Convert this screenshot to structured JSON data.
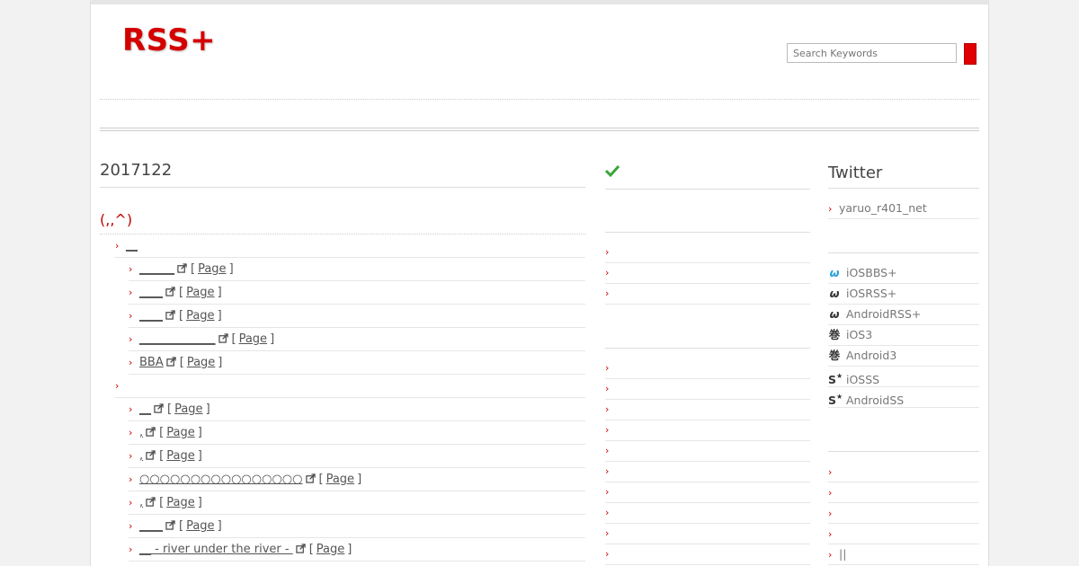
{
  "header": {
    "logo": "RSS+",
    "search_placeholder": "Search Keywords"
  },
  "main": {
    "title": "2017122",
    "section_title": "(,,^)",
    "page_link": "Page",
    "groups": [
      {
        "label": "__",
        "items": [
          {
            "text": "______"
          },
          {
            "text": "____"
          },
          {
            "text": "____"
          },
          {
            "text": "_____________"
          },
          {
            "text": "BBA"
          }
        ]
      },
      {
        "label": "",
        "items": [
          {
            "text": "__"
          },
          {
            "text": ","
          },
          {
            "text": ","
          },
          {
            "text": "○○○○○○○○○○○○○○○○"
          },
          {
            "text": ","
          },
          {
            "text": "____"
          },
          {
            "text": "__ - river under the river - "
          }
        ]
      }
    ]
  },
  "middle": {
    "check_icon": "checkmark-icon",
    "rows_a": [
      "",
      "",
      ""
    ],
    "rows_b": [
      "",
      "",
      "",
      "",
      "",
      "",
      "",
      "",
      "",
      ""
    ]
  },
  "sidebar": {
    "title": "Twitter",
    "twitter_account": "yaruo_r401_net",
    "apps": [
      {
        "icon": "ω",
        "icon_name": "omega-icon",
        "label": "iOSBBS+",
        "color": "#2a9fd6"
      },
      {
        "icon": "ω",
        "icon_name": "omega-icon",
        "label": "iOSRSS+",
        "color": "#333333"
      },
      {
        "icon": "ω",
        "icon_name": "omega-icon",
        "label": "AndroidRSS+",
        "color": "#333333"
      },
      {
        "icon": "巻",
        "icon_name": "scroll-kanji-icon",
        "label": "iOS3",
        "color": "#333333"
      },
      {
        "icon": "巻",
        "icon_name": "scroll-kanji-icon",
        "label": "Android3",
        "color": "#333333"
      },
      {
        "icon": "S",
        "icon_name": "s-star-icon",
        "label": "iOSSS",
        "color": "#333333"
      },
      {
        "icon": "S",
        "icon_name": "s-star-icon",
        "label": "AndroidSS",
        "color": "#333333"
      }
    ],
    "bottom_rows": [
      "",
      "",
      "",
      "",
      "||",
      ""
    ]
  },
  "colors": {
    "accent": "#d40000",
    "check": "#3aa53a"
  }
}
